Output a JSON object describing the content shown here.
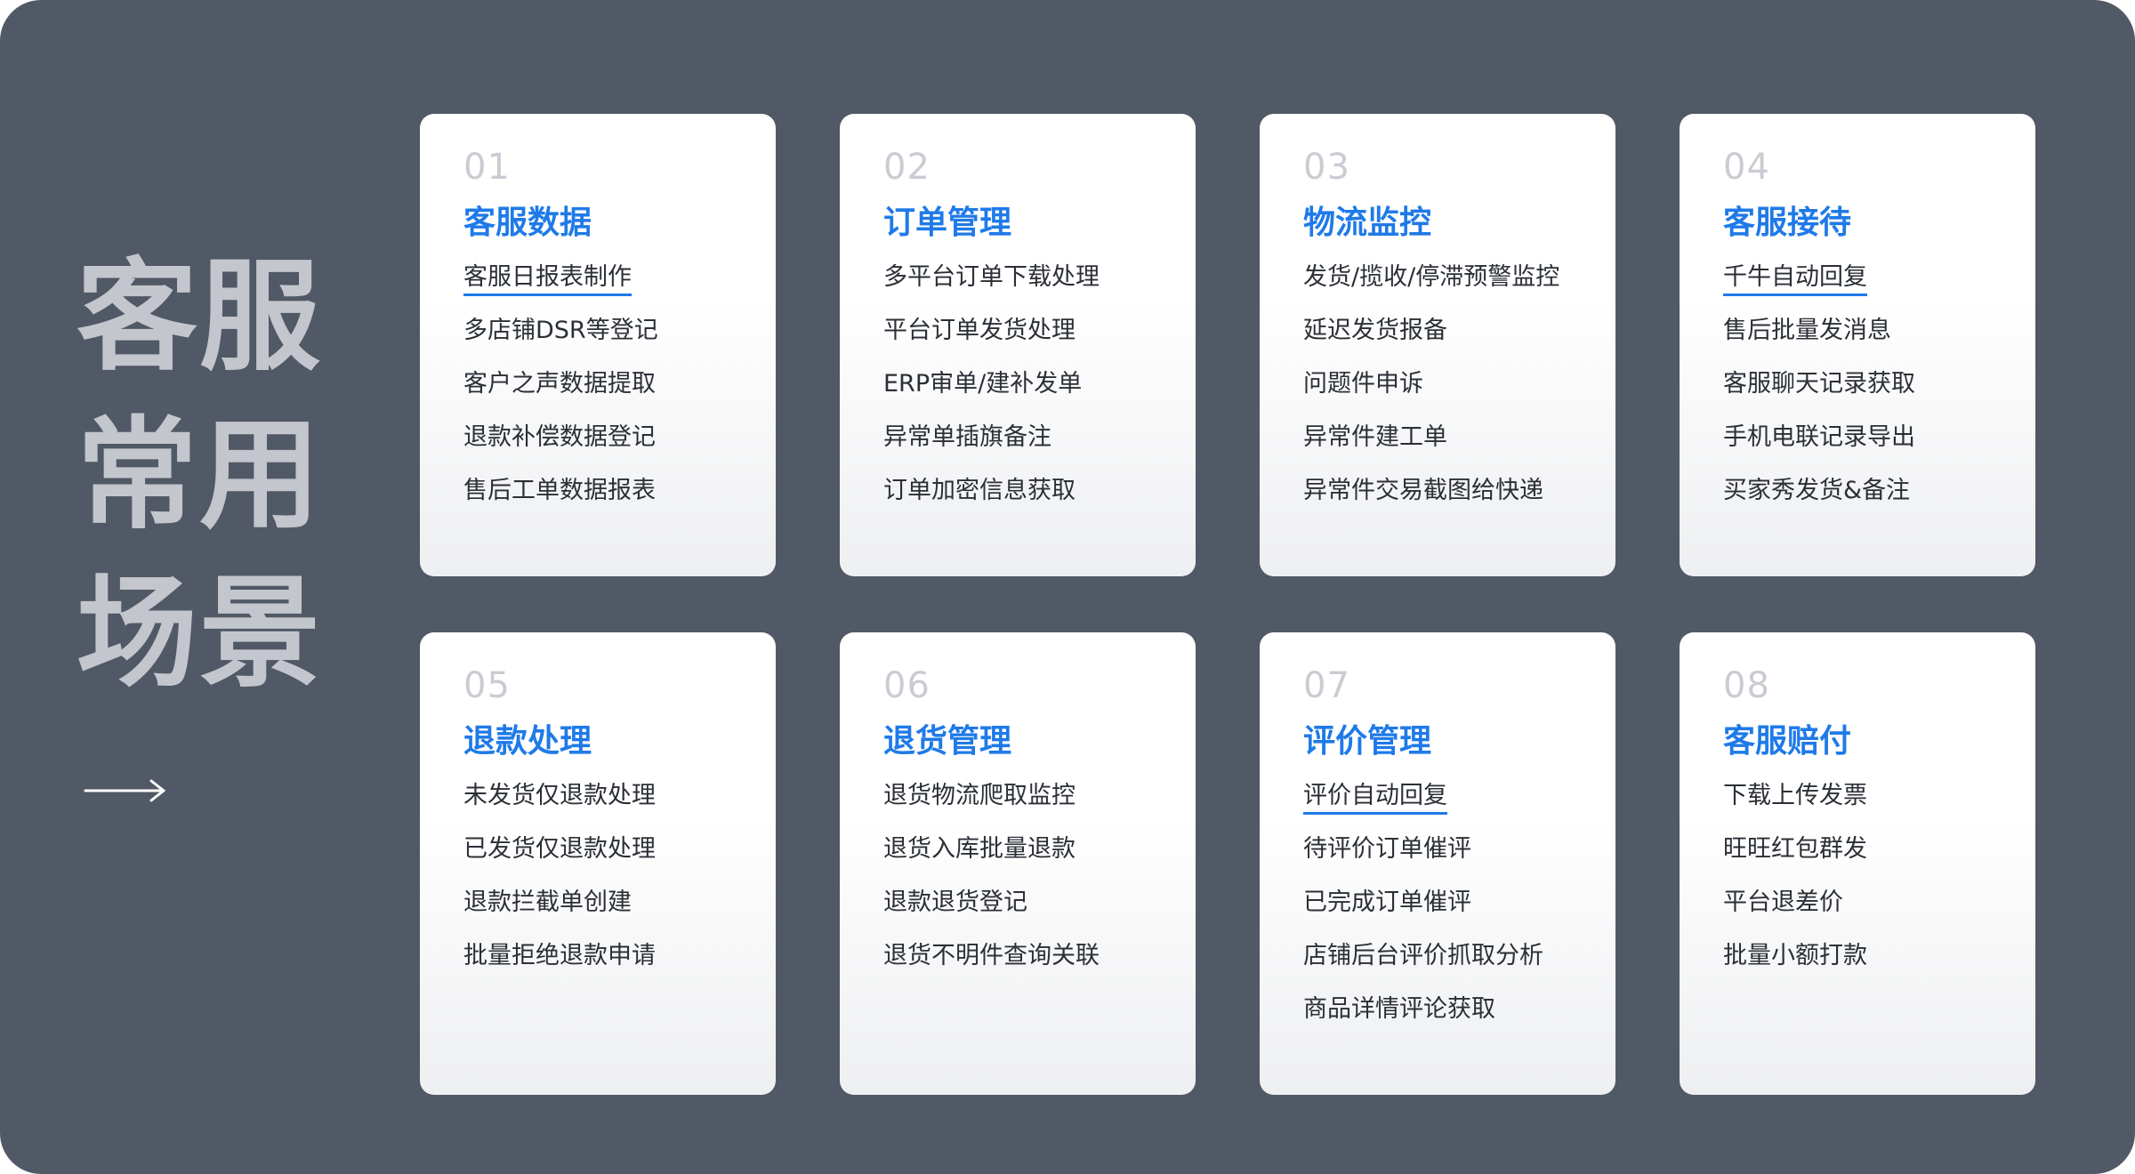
{
  "side": {
    "lines": [
      "客服",
      "常用",
      "场景"
    ],
    "arrow_icon": "arrow-right-icon"
  },
  "colors": {
    "background": "#515866",
    "side_text": "#c3c6cc",
    "accent": "#1f7ae8",
    "number": "#c9ccd2",
    "item_text": "#2b2f36"
  },
  "cards": [
    {
      "number": "01",
      "title": "客服数据",
      "items": [
        {
          "label": "客服日报表制作",
          "active": true
        },
        {
          "label": "多店铺DSR等登记",
          "active": false
        },
        {
          "label": "客户之声数据提取",
          "active": false
        },
        {
          "label": "退款补偿数据登记",
          "active": false
        },
        {
          "label": "售后工单数据报表",
          "active": false
        }
      ]
    },
    {
      "number": "02",
      "title": "订单管理",
      "items": [
        {
          "label": "多平台订单下载处理",
          "active": false
        },
        {
          "label": "平台订单发货处理",
          "active": false
        },
        {
          "label": "ERP审单/建补发单",
          "active": false
        },
        {
          "label": "异常单插旗备注",
          "active": false
        },
        {
          "label": "订单加密信息获取",
          "active": false
        }
      ]
    },
    {
      "number": "03",
      "title": "物流监控",
      "items": [
        {
          "label": "发货/揽收/停滞预警监控",
          "active": false
        },
        {
          "label": "延迟发货报备",
          "active": false
        },
        {
          "label": "问题件申诉",
          "active": false
        },
        {
          "label": "异常件建工单",
          "active": false
        },
        {
          "label": "异常件交易截图给快递",
          "active": false
        }
      ]
    },
    {
      "number": "04",
      "title": "客服接待",
      "items": [
        {
          "label": "千牛自动回复",
          "active": true
        },
        {
          "label": "售后批量发消息",
          "active": false
        },
        {
          "label": "客服聊天记录获取",
          "active": false
        },
        {
          "label": "手机电联记录导出",
          "active": false
        },
        {
          "label": "买家秀发货&备注",
          "active": false
        }
      ]
    },
    {
      "number": "05",
      "title": "退款处理",
      "items": [
        {
          "label": "未发货仅退款处理",
          "active": false
        },
        {
          "label": "已发货仅退款处理",
          "active": false
        },
        {
          "label": "退款拦截单创建",
          "active": false
        },
        {
          "label": "批量拒绝退款申请",
          "active": false
        }
      ]
    },
    {
      "number": "06",
      "title": "退货管理",
      "items": [
        {
          "label": "退货物流爬取监控",
          "active": false
        },
        {
          "label": "退货入库批量退款",
          "active": false
        },
        {
          "label": "退款退货登记",
          "active": false
        },
        {
          "label": "退货不明件查询关联",
          "active": false
        }
      ]
    },
    {
      "number": "07",
      "title": "评价管理",
      "items": [
        {
          "label": "评价自动回复",
          "active": true
        },
        {
          "label": "待评价订单催评",
          "active": false
        },
        {
          "label": "已完成订单催评",
          "active": false
        },
        {
          "label": "店铺后台评价抓取分析",
          "active": false
        },
        {
          "label": "商品详情评论获取",
          "active": false
        }
      ]
    },
    {
      "number": "08",
      "title": "客服赔付",
      "items": [
        {
          "label": "下载上传发票",
          "active": false
        },
        {
          "label": "旺旺红包群发",
          "active": false
        },
        {
          "label": "平台退差价",
          "active": false
        },
        {
          "label": "批量小额打款",
          "active": false
        }
      ]
    }
  ]
}
